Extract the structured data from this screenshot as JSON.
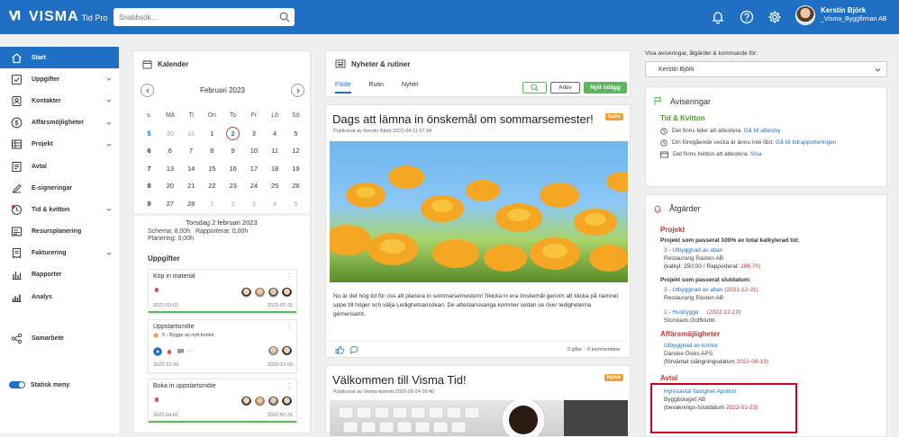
{
  "app": {
    "brand": "VISMA",
    "product": "Tid Pro"
  },
  "search": {
    "placeholder": "Snabbsök..."
  },
  "user": {
    "name": "Kerstin Björk",
    "company": "_Visma_Byggfirman AB"
  },
  "sidebar": {
    "items": [
      {
        "label": "Start",
        "icon": "home-icon",
        "active": true
      },
      {
        "label": "Uppgifter",
        "icon": "checkbox-icon",
        "chevron": true
      },
      {
        "label": "Kontakter",
        "icon": "contacts-icon",
        "chevron": true
      },
      {
        "label": "Affärsmöjligheter",
        "icon": "dollar-icon",
        "chevron": true
      },
      {
        "label": "Projekt",
        "icon": "grid-icon",
        "chevron": true
      },
      {
        "label": "Avtal",
        "icon": "contract-icon"
      },
      {
        "label": "E-signeringar",
        "icon": "esign-icon"
      },
      {
        "label": "Tid & kvitton",
        "icon": "clock-icon",
        "chevron": true
      },
      {
        "label": "Resursplanering",
        "icon": "planning-icon"
      },
      {
        "label": "Fakturering",
        "icon": "invoice-icon",
        "chevron": true
      },
      {
        "label": "Rapporter",
        "icon": "reports-icon"
      },
      {
        "label": "Analys",
        "icon": "analysis-icon"
      }
    ],
    "samarbete": "Samarbete",
    "static_menu": "Statisk meny"
  },
  "calendar": {
    "title": "Kalender",
    "month": "Februari 2023",
    "headers": [
      "v.",
      "Må",
      "Ti",
      "On",
      "To",
      "Fr",
      "Lö",
      "Sö"
    ],
    "weeks": [
      {
        "wk": "5",
        "days": [
          "30",
          "31",
          "1",
          "2",
          "3",
          "4",
          "5"
        ]
      },
      {
        "wk": "6",
        "days": [
          "6",
          "7",
          "8",
          "9",
          "10",
          "11",
          "12"
        ]
      },
      {
        "wk": "7",
        "days": [
          "13",
          "14",
          "15",
          "16",
          "17",
          "18",
          "19"
        ]
      },
      {
        "wk": "8",
        "days": [
          "20",
          "21",
          "22",
          "23",
          "24",
          "25",
          "26"
        ]
      },
      {
        "wk": "9",
        "days": [
          "27",
          "28",
          "1",
          "2",
          "3",
          "4",
          "5"
        ]
      }
    ],
    "selected_day": "Torsdag 2 februari 2023",
    "schema": "Schema: 8,00h",
    "rapporterat": "Rapporterat: 0,00h",
    "planering": "Planering: 0,00h",
    "tasks_title": "Uppgifter",
    "tasks": [
      {
        "title": "Köp in material",
        "start": "2022-03-01",
        "end": "2022-07-31"
      },
      {
        "title": "Uppstartsmöte",
        "sub": "5 - Bygge av nytt kontor",
        "start": "2022-12-09",
        "end": "2022-12-09"
      },
      {
        "title": "Boka in uppstartsmöte",
        "start": "2022-04-01",
        "end": "2022-07-31"
      }
    ]
  },
  "news": {
    "title": "Nyheter & rutiner",
    "tabs": [
      "Flöde",
      "Rutin",
      "Nyhet"
    ],
    "archive": "Arkiv",
    "new_post": "Nytt inlägg",
    "posts": [
      {
        "title": "Dags att lämna in önskemål om sommarsemester!",
        "badge": "Rutin",
        "meta": "Publicerat av Kerstin Björk 2022-04-11 07:34",
        "body": "Nu är det hög tid för oss att planera in sommarsemestern! Skicka in era önskemål genom att klicka på namnet uppe till höger och välja Ledighetsansökan. De attestansvariga kommer sedan se över ledigheterna gemensamt.",
        "likes": "0 gillar",
        "comments": "0 kommentarer"
      },
      {
        "title": "Välkommen till Visma Tid!",
        "badge": "Nyhet",
        "meta": "Publicerat av Visma-teamet 2020-09-24 09:40"
      }
    ]
  },
  "right": {
    "label": "Visa aviseringar, åtgärder & kommande för:",
    "select_value": "Kerstin Björk",
    "notifications": {
      "title": "Aviseringar",
      "section": "Tid & Kvitton",
      "l1_text": "Det finns tider att attestera.",
      "l1_link": "Gå till attestvy",
      "l2_text": "Din föregående vecka är ännu inte låst.",
      "l2_link": "Gå till tidrapporteringen",
      "l3_text": "Det finns kvitton att attestera.",
      "l3_link": "Visa"
    },
    "actions": {
      "title": "Åtgärder",
      "projekt": "Projekt",
      "p_sub1": "Projekt som passerat 100% av total kalkylerad tid:",
      "p1_link": "3 - Utbyggnad av altan",
      "p1_client": "Restaurang Rasten AB",
      "p1_detail_a": "(kalkyl: 250,00 / Rapporterat:",
      "p1_detail_b": "286,70)",
      "p_sub2": "Projekt som passerat slutdatum:",
      "p2_link": "3 - Utbyggnad av altan",
      "p2_date": "(2021-12-31)",
      "p2_client": "Restaurang Rasten AB",
      "p3_link": "1 - Husbygge",
      "p3_date": "(2022-12-19)",
      "p3_client": "Storstads Golfklubb",
      "aff": "Affärsmöjligheter",
      "a_link": "Utbyggnad av kontor",
      "a_client": "Danske Disks APS",
      "a_detail_a": "(förväntat stängningsdatum",
      "a_detail_b": "2022-09-19)",
      "avtal": "Avtal",
      "av_link": "Hyresavtal fastighet Apollon",
      "av_client": "Byggbolaget AB",
      "av_detail_a": "(bevaknings-/slutdatum",
      "av_detail_b": "2023-01-23)"
    }
  },
  "colors": {
    "brand": "#1f6fc5",
    "green": "#5cb85c",
    "red": "#c33",
    "highlight": "#d8001c"
  }
}
